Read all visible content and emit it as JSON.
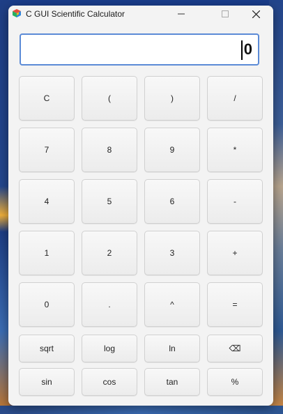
{
  "window": {
    "title": "C GUI Scientific Calculator",
    "icon": "cube-icon"
  },
  "titlebar_buttons": {
    "minimize": "minimize-icon",
    "maximize": "maximize-icon",
    "close": "close-icon"
  },
  "display": {
    "value": "0"
  },
  "keypad": {
    "row1": [
      "C",
      "(",
      ")",
      "/"
    ],
    "row2": [
      "7",
      "8",
      "9",
      "*"
    ],
    "row3": [
      "4",
      "5",
      "6",
      "-"
    ],
    "row4": [
      "1",
      "2",
      "3",
      "+"
    ],
    "row5": [
      "0",
      ".",
      "^",
      "="
    ],
    "row6": [
      "sqrt",
      "log",
      "ln",
      "⌫"
    ],
    "row7": [
      "sin",
      "cos",
      "tan",
      "%"
    ]
  },
  "colors": {
    "window_bg": "#f3f3f3",
    "display_border": "#5b8ad6",
    "key_border": "#d0d0d0"
  }
}
